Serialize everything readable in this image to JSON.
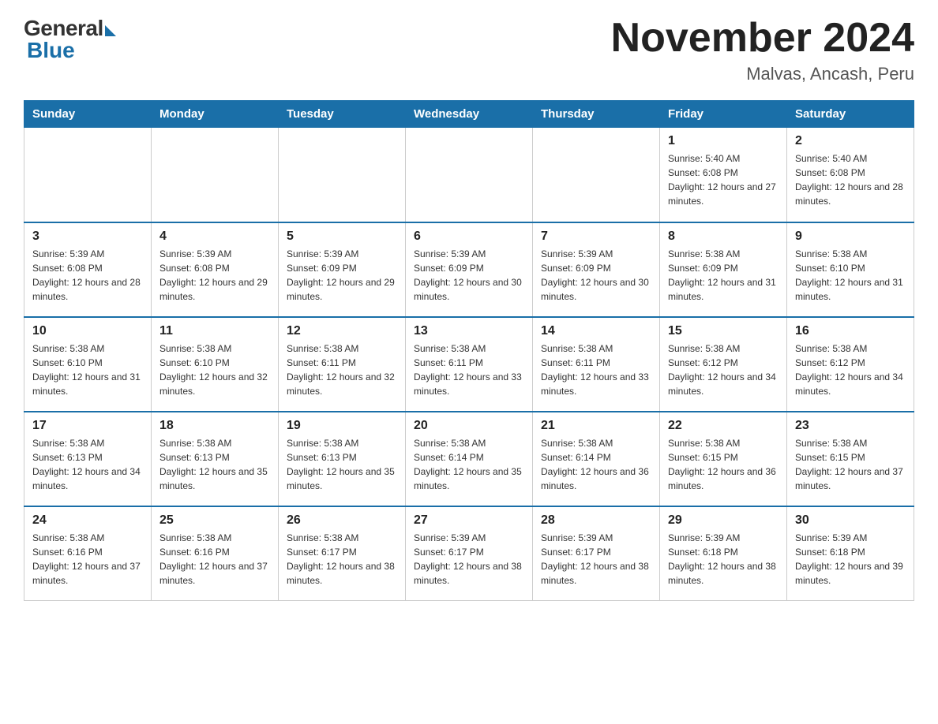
{
  "logo": {
    "general": "General",
    "blue": "Blue"
  },
  "header": {
    "month_year": "November 2024",
    "location": "Malvas, Ancash, Peru"
  },
  "weekdays": [
    "Sunday",
    "Monday",
    "Tuesday",
    "Wednesday",
    "Thursday",
    "Friday",
    "Saturday"
  ],
  "weeks": [
    [
      {
        "day": "",
        "sunrise": "",
        "sunset": "",
        "daylight": ""
      },
      {
        "day": "",
        "sunrise": "",
        "sunset": "",
        "daylight": ""
      },
      {
        "day": "",
        "sunrise": "",
        "sunset": "",
        "daylight": ""
      },
      {
        "day": "",
        "sunrise": "",
        "sunset": "",
        "daylight": ""
      },
      {
        "day": "",
        "sunrise": "",
        "sunset": "",
        "daylight": ""
      },
      {
        "day": "1",
        "sunrise": "Sunrise: 5:40 AM",
        "sunset": "Sunset: 6:08 PM",
        "daylight": "Daylight: 12 hours and 27 minutes."
      },
      {
        "day": "2",
        "sunrise": "Sunrise: 5:40 AM",
        "sunset": "Sunset: 6:08 PM",
        "daylight": "Daylight: 12 hours and 28 minutes."
      }
    ],
    [
      {
        "day": "3",
        "sunrise": "Sunrise: 5:39 AM",
        "sunset": "Sunset: 6:08 PM",
        "daylight": "Daylight: 12 hours and 28 minutes."
      },
      {
        "day": "4",
        "sunrise": "Sunrise: 5:39 AM",
        "sunset": "Sunset: 6:08 PM",
        "daylight": "Daylight: 12 hours and 29 minutes."
      },
      {
        "day": "5",
        "sunrise": "Sunrise: 5:39 AM",
        "sunset": "Sunset: 6:09 PM",
        "daylight": "Daylight: 12 hours and 29 minutes."
      },
      {
        "day": "6",
        "sunrise": "Sunrise: 5:39 AM",
        "sunset": "Sunset: 6:09 PM",
        "daylight": "Daylight: 12 hours and 30 minutes."
      },
      {
        "day": "7",
        "sunrise": "Sunrise: 5:39 AM",
        "sunset": "Sunset: 6:09 PM",
        "daylight": "Daylight: 12 hours and 30 minutes."
      },
      {
        "day": "8",
        "sunrise": "Sunrise: 5:38 AM",
        "sunset": "Sunset: 6:09 PM",
        "daylight": "Daylight: 12 hours and 31 minutes."
      },
      {
        "day": "9",
        "sunrise": "Sunrise: 5:38 AM",
        "sunset": "Sunset: 6:10 PM",
        "daylight": "Daylight: 12 hours and 31 minutes."
      }
    ],
    [
      {
        "day": "10",
        "sunrise": "Sunrise: 5:38 AM",
        "sunset": "Sunset: 6:10 PM",
        "daylight": "Daylight: 12 hours and 31 minutes."
      },
      {
        "day": "11",
        "sunrise": "Sunrise: 5:38 AM",
        "sunset": "Sunset: 6:10 PM",
        "daylight": "Daylight: 12 hours and 32 minutes."
      },
      {
        "day": "12",
        "sunrise": "Sunrise: 5:38 AM",
        "sunset": "Sunset: 6:11 PM",
        "daylight": "Daylight: 12 hours and 32 minutes."
      },
      {
        "day": "13",
        "sunrise": "Sunrise: 5:38 AM",
        "sunset": "Sunset: 6:11 PM",
        "daylight": "Daylight: 12 hours and 33 minutes."
      },
      {
        "day": "14",
        "sunrise": "Sunrise: 5:38 AM",
        "sunset": "Sunset: 6:11 PM",
        "daylight": "Daylight: 12 hours and 33 minutes."
      },
      {
        "day": "15",
        "sunrise": "Sunrise: 5:38 AM",
        "sunset": "Sunset: 6:12 PM",
        "daylight": "Daylight: 12 hours and 34 minutes."
      },
      {
        "day": "16",
        "sunrise": "Sunrise: 5:38 AM",
        "sunset": "Sunset: 6:12 PM",
        "daylight": "Daylight: 12 hours and 34 minutes."
      }
    ],
    [
      {
        "day": "17",
        "sunrise": "Sunrise: 5:38 AM",
        "sunset": "Sunset: 6:13 PM",
        "daylight": "Daylight: 12 hours and 34 minutes."
      },
      {
        "day": "18",
        "sunrise": "Sunrise: 5:38 AM",
        "sunset": "Sunset: 6:13 PM",
        "daylight": "Daylight: 12 hours and 35 minutes."
      },
      {
        "day": "19",
        "sunrise": "Sunrise: 5:38 AM",
        "sunset": "Sunset: 6:13 PM",
        "daylight": "Daylight: 12 hours and 35 minutes."
      },
      {
        "day": "20",
        "sunrise": "Sunrise: 5:38 AM",
        "sunset": "Sunset: 6:14 PM",
        "daylight": "Daylight: 12 hours and 35 minutes."
      },
      {
        "day": "21",
        "sunrise": "Sunrise: 5:38 AM",
        "sunset": "Sunset: 6:14 PM",
        "daylight": "Daylight: 12 hours and 36 minutes."
      },
      {
        "day": "22",
        "sunrise": "Sunrise: 5:38 AM",
        "sunset": "Sunset: 6:15 PM",
        "daylight": "Daylight: 12 hours and 36 minutes."
      },
      {
        "day": "23",
        "sunrise": "Sunrise: 5:38 AM",
        "sunset": "Sunset: 6:15 PM",
        "daylight": "Daylight: 12 hours and 37 minutes."
      }
    ],
    [
      {
        "day": "24",
        "sunrise": "Sunrise: 5:38 AM",
        "sunset": "Sunset: 6:16 PM",
        "daylight": "Daylight: 12 hours and 37 minutes."
      },
      {
        "day": "25",
        "sunrise": "Sunrise: 5:38 AM",
        "sunset": "Sunset: 6:16 PM",
        "daylight": "Daylight: 12 hours and 37 minutes."
      },
      {
        "day": "26",
        "sunrise": "Sunrise: 5:38 AM",
        "sunset": "Sunset: 6:17 PM",
        "daylight": "Daylight: 12 hours and 38 minutes."
      },
      {
        "day": "27",
        "sunrise": "Sunrise: 5:39 AM",
        "sunset": "Sunset: 6:17 PM",
        "daylight": "Daylight: 12 hours and 38 minutes."
      },
      {
        "day": "28",
        "sunrise": "Sunrise: 5:39 AM",
        "sunset": "Sunset: 6:17 PM",
        "daylight": "Daylight: 12 hours and 38 minutes."
      },
      {
        "day": "29",
        "sunrise": "Sunrise: 5:39 AM",
        "sunset": "Sunset: 6:18 PM",
        "daylight": "Daylight: 12 hours and 38 minutes."
      },
      {
        "day": "30",
        "sunrise": "Sunrise: 5:39 AM",
        "sunset": "Sunset: 6:18 PM",
        "daylight": "Daylight: 12 hours and 39 minutes."
      }
    ]
  ]
}
